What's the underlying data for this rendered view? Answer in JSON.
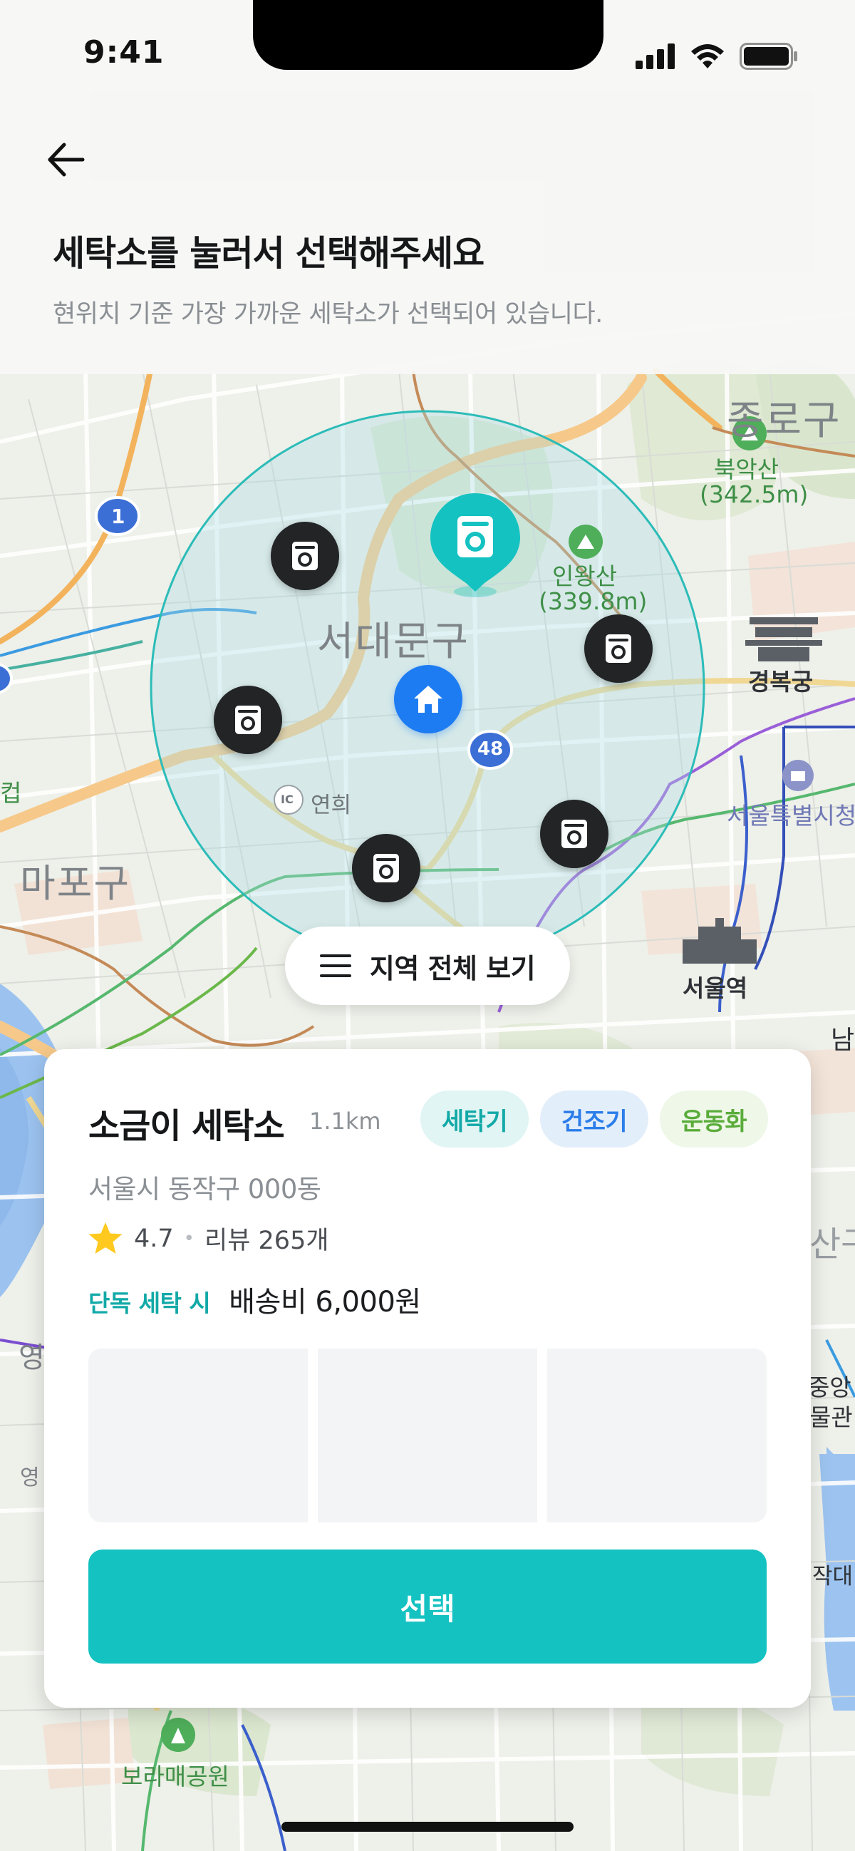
{
  "status_bar": {
    "time": "9:41"
  },
  "header": {
    "title": "세탁소를 눌러서 선택해주세요",
    "subtitle": "현위치 기준 가장 가까운 세탁소가 선택되어 있습니다."
  },
  "map": {
    "district_labels": {
      "seodaemun": "서대문구",
      "mapo": "마포구",
      "jongno": "종로구"
    },
    "places": {
      "bukaksan_name": "북악산",
      "bukaksan_height": "(342.5m)",
      "inwangsan_name": "인왕산",
      "inwangsan_height": "(339.8m)",
      "gyeongbokgung": "경복궁",
      "seoul_city_hall": "서울특별시청",
      "seoul_station": "서울역",
      "yeonhui": "연희",
      "borame_park": "보라매공원",
      "ic": "IC"
    },
    "road_badges": {
      "route_1": "1",
      "route_48": "48"
    },
    "edge_fragments": {
      "left_1": "컵",
      "left_2": "영",
      "left_3": "영",
      "right_1": "남",
      "right_2": "산구",
      "right_3": "중앙",
      "right_4": "물관",
      "right_5": "작대"
    },
    "view_all_label": "지역 전체 보기"
  },
  "store": {
    "name": "소금이 세탁소",
    "distance": "1.1km",
    "tags": [
      "세탁기",
      "건조기",
      "운동화"
    ],
    "address": "서울시 동작구 000동",
    "rating": "4.7",
    "reviews": "리뷰 265개",
    "fee_label": "단독 세탁 시",
    "fee_value": "배송비 6,000원",
    "select_label": "선택"
  },
  "colors": {
    "accent": "#14c2c1",
    "home_pin": "#1e7cf2",
    "pin_dark": "#222426"
  },
  "icons": {
    "back": "arrow-left-icon",
    "washer": "washing-machine-icon",
    "home": "home-icon",
    "menu": "hamburger-icon",
    "star": "star-icon"
  }
}
